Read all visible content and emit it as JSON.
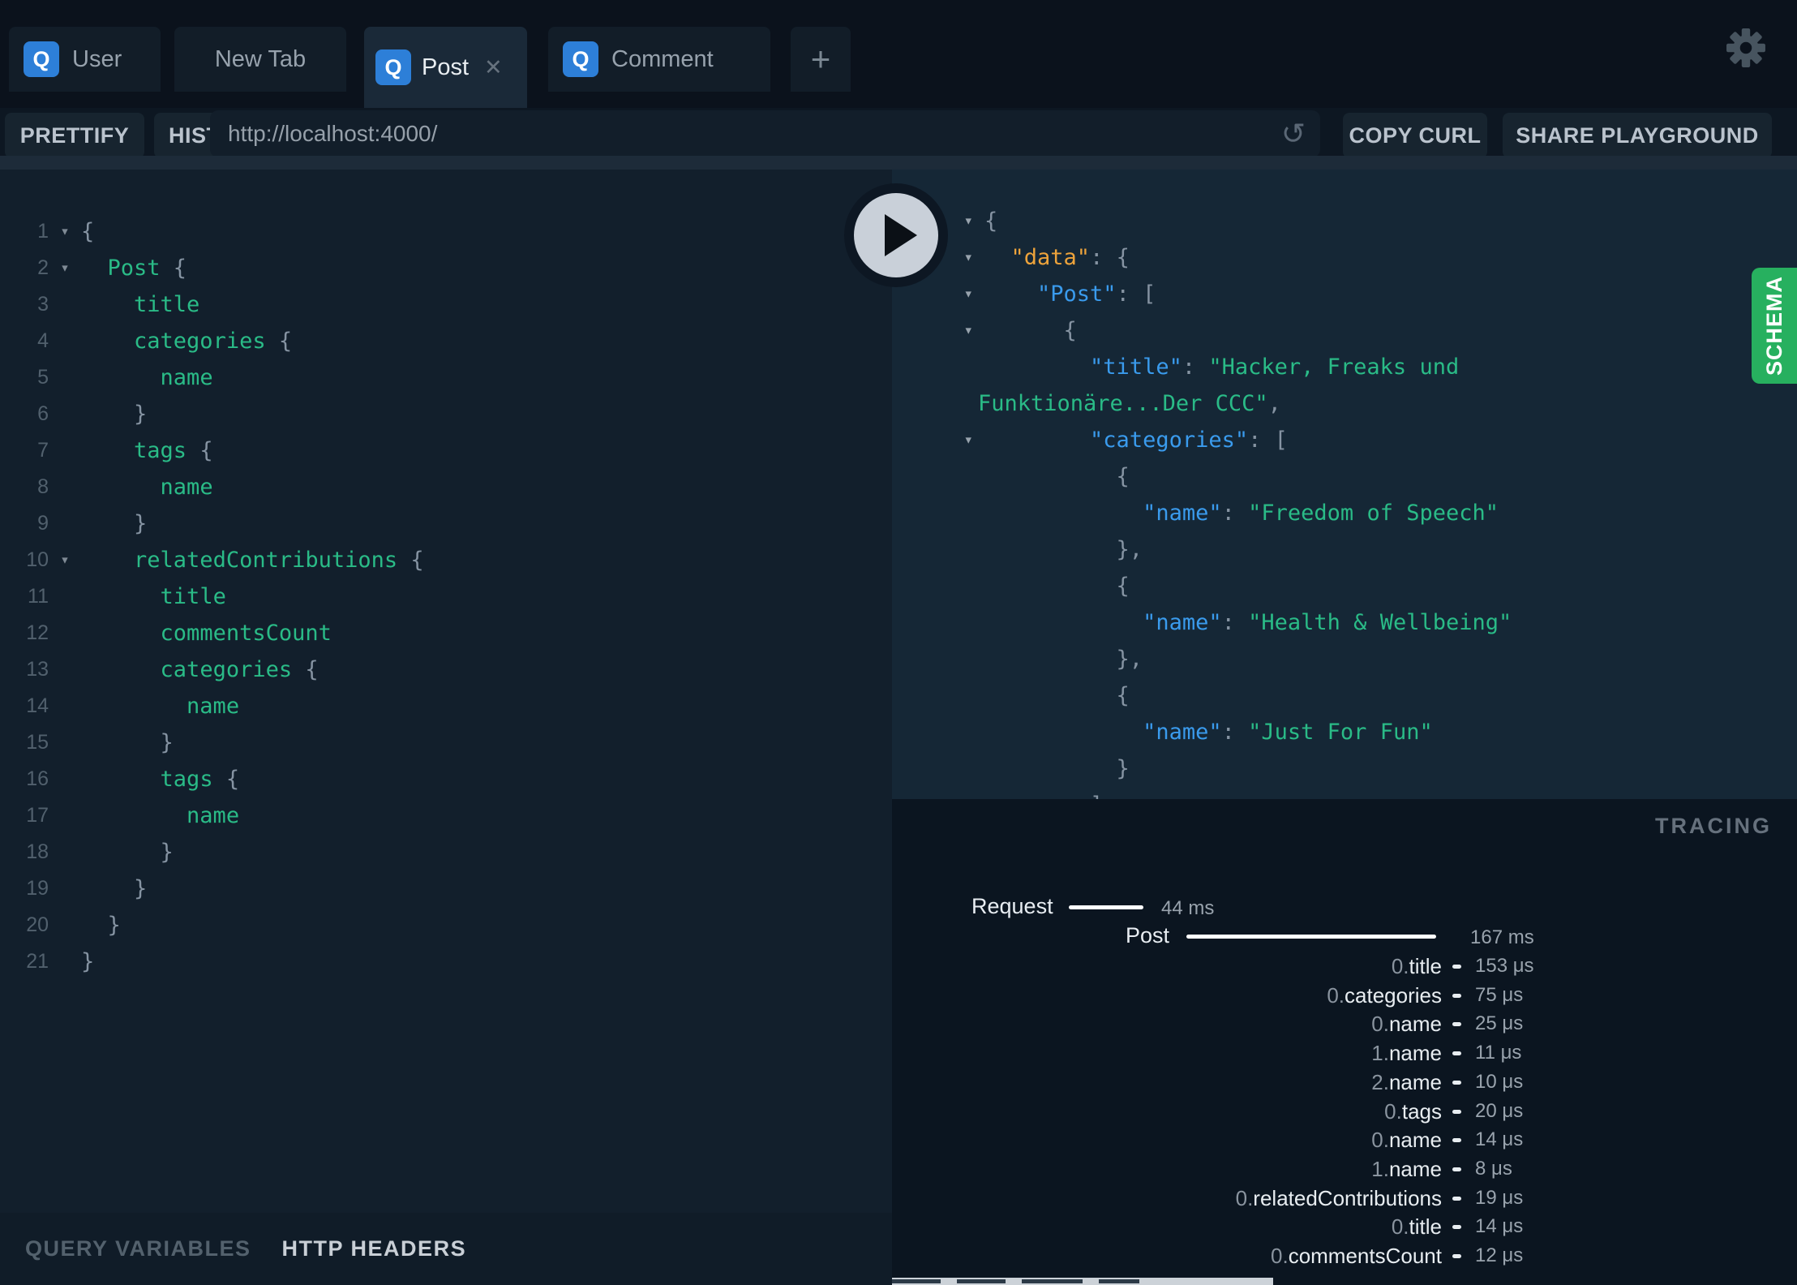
{
  "tabs": {
    "items": [
      {
        "label": "User"
      },
      {
        "label": "New Tab"
      },
      {
        "label": "Post"
      },
      {
        "label": "Comment"
      }
    ],
    "badge_letter": "Q",
    "close_icon": "✕",
    "new_tab_icon": "+"
  },
  "toolbar": {
    "prettify": "PRETTIFY",
    "history": "HISTORY",
    "url": "http://localhost:4000/",
    "reload_icon": "↺",
    "copy_curl": "COPY CURL",
    "share_playground": "SHARE PLAYGROUND"
  },
  "editor": {
    "lines": [
      {
        "num": 1,
        "fold": true,
        "segs": [
          [
            "p",
            "{"
          ]
        ]
      },
      {
        "num": 2,
        "fold": true,
        "segs": [
          [
            "p",
            "  "
          ],
          [
            "g",
            "Post"
          ],
          [
            "p",
            " {"
          ]
        ]
      },
      {
        "num": 3,
        "fold": false,
        "segs": [
          [
            "p",
            "    "
          ],
          [
            "g",
            "title"
          ]
        ]
      },
      {
        "num": 4,
        "fold": false,
        "segs": [
          [
            "p",
            "    "
          ],
          [
            "g",
            "categories"
          ],
          [
            "p",
            " {"
          ]
        ]
      },
      {
        "num": 5,
        "fold": false,
        "segs": [
          [
            "p",
            "      "
          ],
          [
            "g",
            "name"
          ]
        ]
      },
      {
        "num": 6,
        "fold": false,
        "segs": [
          [
            "p",
            "    }"
          ]
        ]
      },
      {
        "num": 7,
        "fold": false,
        "segs": [
          [
            "p",
            "    "
          ],
          [
            "g",
            "tags"
          ],
          [
            "p",
            " {"
          ]
        ]
      },
      {
        "num": 8,
        "fold": false,
        "segs": [
          [
            "p",
            "      "
          ],
          [
            "g",
            "name"
          ]
        ]
      },
      {
        "num": 9,
        "fold": false,
        "segs": [
          [
            "p",
            "    }"
          ]
        ]
      },
      {
        "num": 10,
        "fold": true,
        "segs": [
          [
            "p",
            "    "
          ],
          [
            "g",
            "relatedContributions"
          ],
          [
            "p",
            " {"
          ]
        ]
      },
      {
        "num": 11,
        "fold": false,
        "segs": [
          [
            "p",
            "      "
          ],
          [
            "g",
            "title"
          ]
        ]
      },
      {
        "num": 12,
        "fold": false,
        "segs": [
          [
            "p",
            "      "
          ],
          [
            "g",
            "commentsCount"
          ]
        ]
      },
      {
        "num": 13,
        "fold": false,
        "segs": [
          [
            "p",
            "      "
          ],
          [
            "g",
            "categories"
          ],
          [
            "p",
            " {"
          ]
        ]
      },
      {
        "num": 14,
        "fold": false,
        "segs": [
          [
            "p",
            "        "
          ],
          [
            "g",
            "name"
          ]
        ]
      },
      {
        "num": 15,
        "fold": false,
        "segs": [
          [
            "p",
            "      }"
          ]
        ]
      },
      {
        "num": 16,
        "fold": false,
        "segs": [
          [
            "p",
            "      "
          ],
          [
            "g",
            "tags"
          ],
          [
            "p",
            " {"
          ]
        ]
      },
      {
        "num": 17,
        "fold": false,
        "segs": [
          [
            "p",
            "        "
          ],
          [
            "g",
            "name"
          ]
        ]
      },
      {
        "num": 18,
        "fold": false,
        "segs": [
          [
            "p",
            "      }"
          ]
        ]
      },
      {
        "num": 19,
        "fold": false,
        "segs": [
          [
            "p",
            "    }"
          ]
        ]
      },
      {
        "num": 20,
        "fold": false,
        "segs": [
          [
            "p",
            "  }"
          ]
        ]
      },
      {
        "num": 21,
        "fold": false,
        "segs": [
          [
            "p",
            "}"
          ]
        ]
      }
    ]
  },
  "response": {
    "lines": [
      {
        "fold": true,
        "wrap": false,
        "segs": [
          [
            "p",
            "{"
          ]
        ]
      },
      {
        "fold": true,
        "wrap": false,
        "segs": [
          [
            "p",
            "  "
          ],
          [
            "o",
            "\"data\""
          ],
          [
            "p",
            ": {"
          ]
        ]
      },
      {
        "fold": true,
        "wrap": false,
        "segs": [
          [
            "p",
            "    "
          ],
          [
            "b",
            "\"Post\""
          ],
          [
            "p",
            ": ["
          ]
        ]
      },
      {
        "fold": true,
        "wrap": false,
        "segs": [
          [
            "p",
            "      {"
          ]
        ]
      },
      {
        "fold": false,
        "wrap": false,
        "segs": [
          [
            "p",
            "        "
          ],
          [
            "b",
            "\"title\""
          ],
          [
            "p",
            ": "
          ],
          [
            "g",
            "\"Hacker, Freaks und"
          ]
        ]
      },
      {
        "fold": false,
        "wrap": true,
        "segs": [
          [
            "g",
            "Funktionäre...Der CCC\""
          ],
          [
            "p",
            ","
          ]
        ]
      },
      {
        "fold": true,
        "wrap": false,
        "segs": [
          [
            "p",
            "        "
          ],
          [
            "b",
            "\"categories\""
          ],
          [
            "p",
            ": ["
          ]
        ]
      },
      {
        "fold": false,
        "wrap": false,
        "segs": [
          [
            "p",
            "          {"
          ]
        ]
      },
      {
        "fold": false,
        "wrap": false,
        "segs": [
          [
            "p",
            "            "
          ],
          [
            "b",
            "\"name\""
          ],
          [
            "p",
            ": "
          ],
          [
            "g",
            "\"Freedom of Speech\""
          ]
        ]
      },
      {
        "fold": false,
        "wrap": false,
        "segs": [
          [
            "p",
            "          },"
          ]
        ]
      },
      {
        "fold": false,
        "wrap": false,
        "segs": [
          [
            "p",
            "          {"
          ]
        ]
      },
      {
        "fold": false,
        "wrap": false,
        "segs": [
          [
            "p",
            "            "
          ],
          [
            "b",
            "\"name\""
          ],
          [
            "p",
            ": "
          ],
          [
            "g",
            "\"Health & Wellbeing\""
          ]
        ]
      },
      {
        "fold": false,
        "wrap": false,
        "segs": [
          [
            "p",
            "          },"
          ]
        ]
      },
      {
        "fold": false,
        "wrap": false,
        "segs": [
          [
            "p",
            "          {"
          ]
        ]
      },
      {
        "fold": false,
        "wrap": false,
        "segs": [
          [
            "p",
            "            "
          ],
          [
            "b",
            "\"name\""
          ],
          [
            "p",
            ": "
          ],
          [
            "g",
            "\"Just For Fun\""
          ]
        ]
      },
      {
        "fold": false,
        "wrap": false,
        "segs": [
          [
            "p",
            "          }"
          ]
        ]
      },
      {
        "fold": false,
        "wrap": false,
        "segs": [
          [
            "p",
            "        ]"
          ]
        ]
      }
    ]
  },
  "tracing": {
    "title": "TRACING",
    "request": {
      "label": "Request",
      "time": "44 ms"
    },
    "root": {
      "label": "Post",
      "time": "167 ms"
    },
    "rows": [
      {
        "prefix": "0.",
        "name": "title",
        "time": "153 μs"
      },
      {
        "prefix": "0.",
        "name": "categories",
        "time": "75 μs"
      },
      {
        "prefix": "0.",
        "name": "name",
        "time": "25 μs"
      },
      {
        "prefix": "1.",
        "name": "name",
        "time": "11 μs"
      },
      {
        "prefix": "2.",
        "name": "name",
        "time": "10 μs"
      },
      {
        "prefix": "0.",
        "name": "tags",
        "time": "20 μs"
      },
      {
        "prefix": "0.",
        "name": "name",
        "time": "14 μs"
      },
      {
        "prefix": "1.",
        "name": "name",
        "time": "8 μs"
      },
      {
        "prefix": "0.",
        "name": "relatedContributions",
        "time": "19 μs"
      },
      {
        "prefix": "0.",
        "name": "title",
        "time": "14 μs"
      },
      {
        "prefix": "0.",
        "name": "commentsCount",
        "time": "12 μs"
      }
    ]
  },
  "footer": {
    "query_variables": "QUERY VARIABLES",
    "http_headers": "HTTP HEADERS"
  },
  "schema": {
    "label": "SCHEMA"
  },
  "icons": {
    "fold": "▾"
  },
  "colors": {
    "accent_blue": "#2d7fd8",
    "schema_green": "#27b05f",
    "field_green": "#2abb87",
    "key_blue": "#3a9bed",
    "data_orange": "#eda33b"
  }
}
